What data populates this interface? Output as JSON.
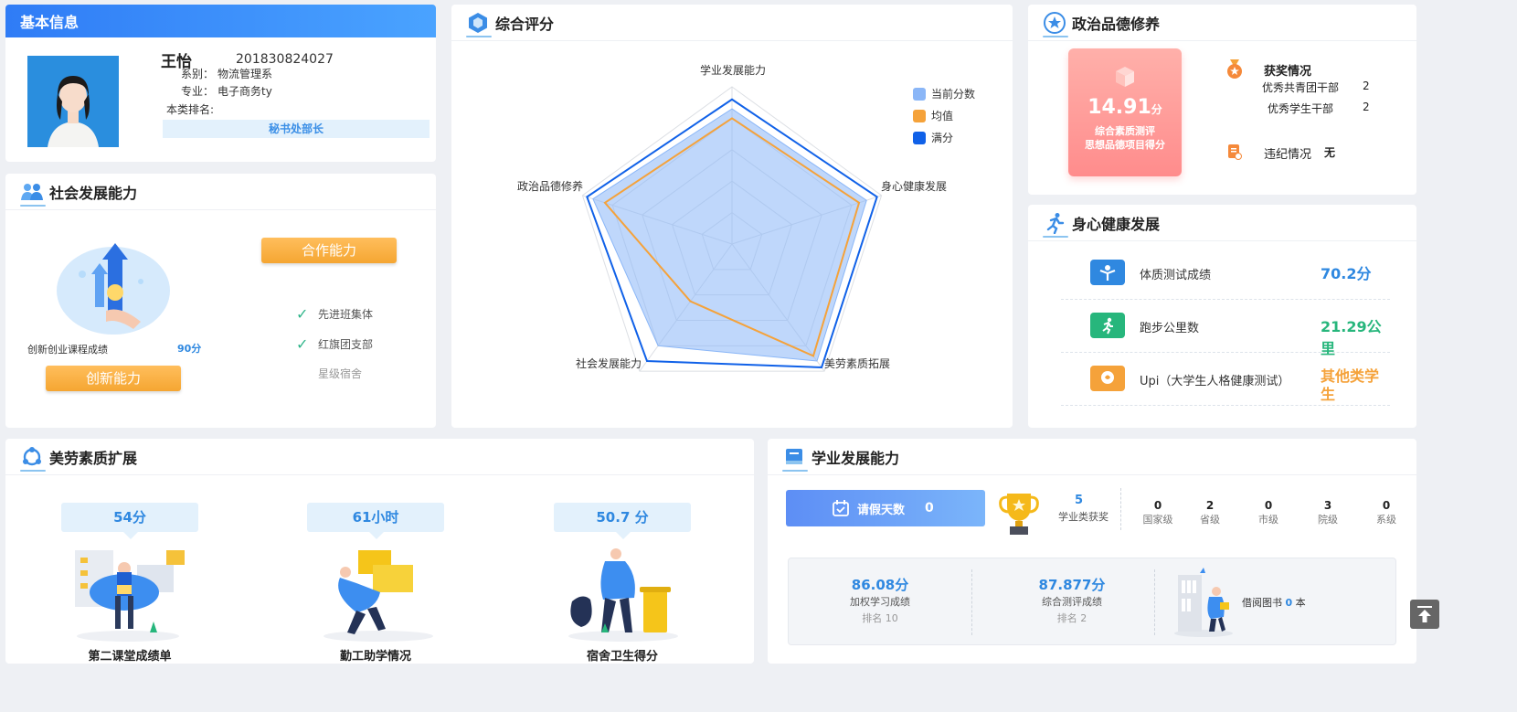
{
  "basic": {
    "title": "基本信息",
    "name": "王怡",
    "student_id": "201830824027",
    "dept_label": "系别：",
    "dept": "物流管理系",
    "major_label": "专业：",
    "major": "电子商务ty",
    "rank_label": "本类排名:",
    "position": "秘书处部长"
  },
  "social": {
    "title": "社会发展能力",
    "cooperation": "合作能力",
    "innovation": "创新能力",
    "course_label": "创新创业课程成绩",
    "course_score": "90分",
    "honors": [
      {
        "label": "先进班集体",
        "checked": true
      },
      {
        "label": "红旗团支部",
        "checked": true
      },
      {
        "label": "星级宿舍",
        "checked": false
      }
    ]
  },
  "radar": {
    "title": "综合评分",
    "axes": [
      "学业发展能力",
      "身心健康发展",
      "美劳素质拓展",
      "社会发展能力",
      "政治品德修养"
    ],
    "legend": [
      "当前分数",
      "均值",
      "满分"
    ],
    "colors": {
      "current": "#8ab6f7",
      "mean": "#f5a23a",
      "max": "#1061e8"
    }
  },
  "chart_data": {
    "type": "radar",
    "categories": [
      "学业发展能力",
      "身心健康发展",
      "美劳素质拓展",
      "社会发展能力",
      "政治品德修养"
    ],
    "series": [
      {
        "name": "当前分数",
        "values": [
          86,
          90,
          92,
          80,
          93
        ]
      },
      {
        "name": "均值",
        "values": [
          80,
          85,
          88,
          45,
          85
        ]
      },
      {
        "name": "满分",
        "values": [
          92,
          97,
          97,
          92,
          97
        ]
      }
    ],
    "ylim": [
      0,
      100
    ],
    "grid": true,
    "legend_position": "top-right"
  },
  "political": {
    "title": "政治品德修养",
    "score": "14.91",
    "score_unit": "分",
    "score_desc_1": "综合素质测评",
    "score_desc_2": "思想品德项目得分",
    "awards_title": "获奖情况",
    "awards": [
      {
        "label": "优秀共青团干部",
        "count": "2"
      },
      {
        "label": "优秀学生干部",
        "count": "2"
      }
    ],
    "violation_label": "违纪情况",
    "violation_value": "无"
  },
  "health": {
    "title": "身心健康发展",
    "rows": [
      {
        "label": "体质测试成绩",
        "value": "70.2分",
        "color": "#2f88e0"
      },
      {
        "label": "跑步公里数",
        "value": "21.29公里",
        "color": "#27b67c"
      },
      {
        "label": "Upi（大学生人格健康测试）",
        "value": "其他类学生",
        "color": "#f5a23a"
      }
    ]
  },
  "aesthetics": {
    "title": "美劳素质扩展",
    "items": [
      {
        "value": "54分",
        "caption": "第二课堂成绩单"
      },
      {
        "value": "61小时",
        "caption": "勤工助学情况"
      },
      {
        "value": "50.7 分",
        "caption": "宿舍卫生得分"
      }
    ]
  },
  "academic": {
    "title": "学业发展能力",
    "leave_label": "请假天数",
    "leave_count": "0",
    "award_count": "5",
    "award_label": "学业类获奖",
    "levels": [
      {
        "n": "0",
        "l": "国家级"
      },
      {
        "n": "2",
        "l": "省级"
      },
      {
        "n": "0",
        "l": "市级"
      },
      {
        "n": "3",
        "l": "院级"
      },
      {
        "n": "0",
        "l": "系级"
      }
    ],
    "weighted_score": "86.08分",
    "weighted_label": "加权学习成绩",
    "weighted_rank": "排名 10",
    "overall_score": "87.877分",
    "overall_label": "综合测评成绩",
    "overall_rank": "排名 2",
    "books_prefix": "借阅图书",
    "books_count": "0",
    "books_suffix": "本"
  }
}
